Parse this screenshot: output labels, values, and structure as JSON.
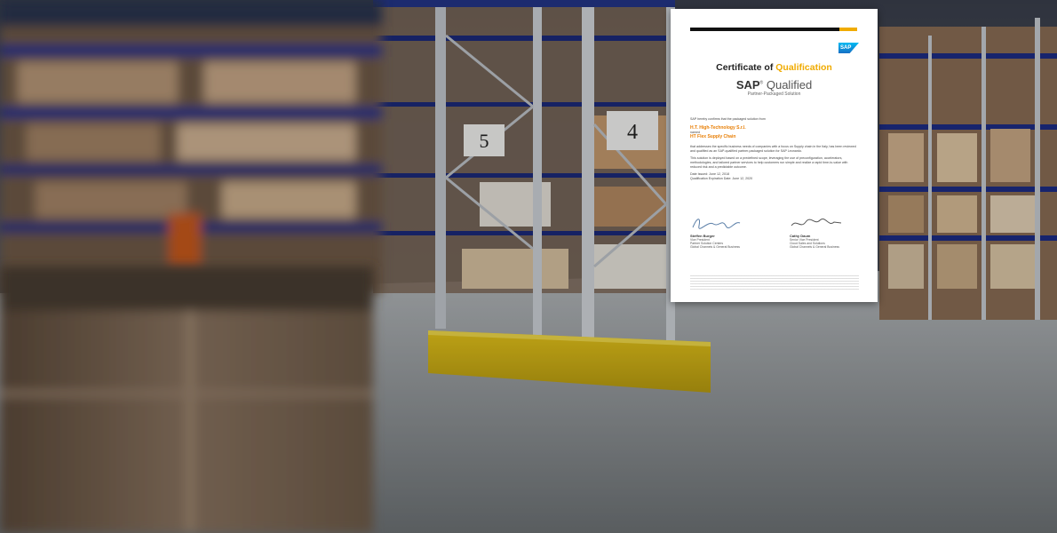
{
  "scene": {
    "description_colors": {
      "shelf_blue": "#1e2f7a",
      "shelf_orange": "#c85a1a",
      "barrier_yellow": "#e0c016",
      "floor": "#8d9396"
    },
    "rack_labels": [
      "5",
      "4"
    ]
  },
  "certificate": {
    "title_prefix": "Certificate of",
    "title_highlight": "Qualification",
    "qualified_brand": "SAP",
    "qualified_word": "Qualified",
    "qualified_sub": "Partner-Packaged Solution",
    "logo": "SAP",
    "intro": "SAP hereby confirms that the packaged solution from",
    "company": "H.T. High-Technology S.r.l.",
    "named": "named",
    "solution": "HT Flex Supply Chain",
    "para1": "that addresses the specific business needs of companies with a focus on Supply chain in the Italy, has been reviewed and qualified as an SAP-qualified partner-packaged solution for SAP Leonardo.",
    "para2": "This solution is deployed based on a predefined scope, leveraging the use of preconfiguration, accelerators, methodologies, and tailored partner services to help customers run simple and realize a rapid time-to-value with reduced risk and a predictable outcome.",
    "date_issued": "Date Issued: June 12, 2018",
    "expiration": "Qualification Expiration Date: June 12, 2020",
    "signer_left": {
      "name": "Steffen Burger",
      "role1": "Vice President",
      "role2": "Partner Solution Centers",
      "role3": "Global Channels & General Business"
    },
    "signer_right": {
      "name": "Cathy Daum",
      "role1": "Senior Vice President",
      "role2": "Cloud Sales and Solutions",
      "role3": "Global Channels & General Business"
    }
  }
}
